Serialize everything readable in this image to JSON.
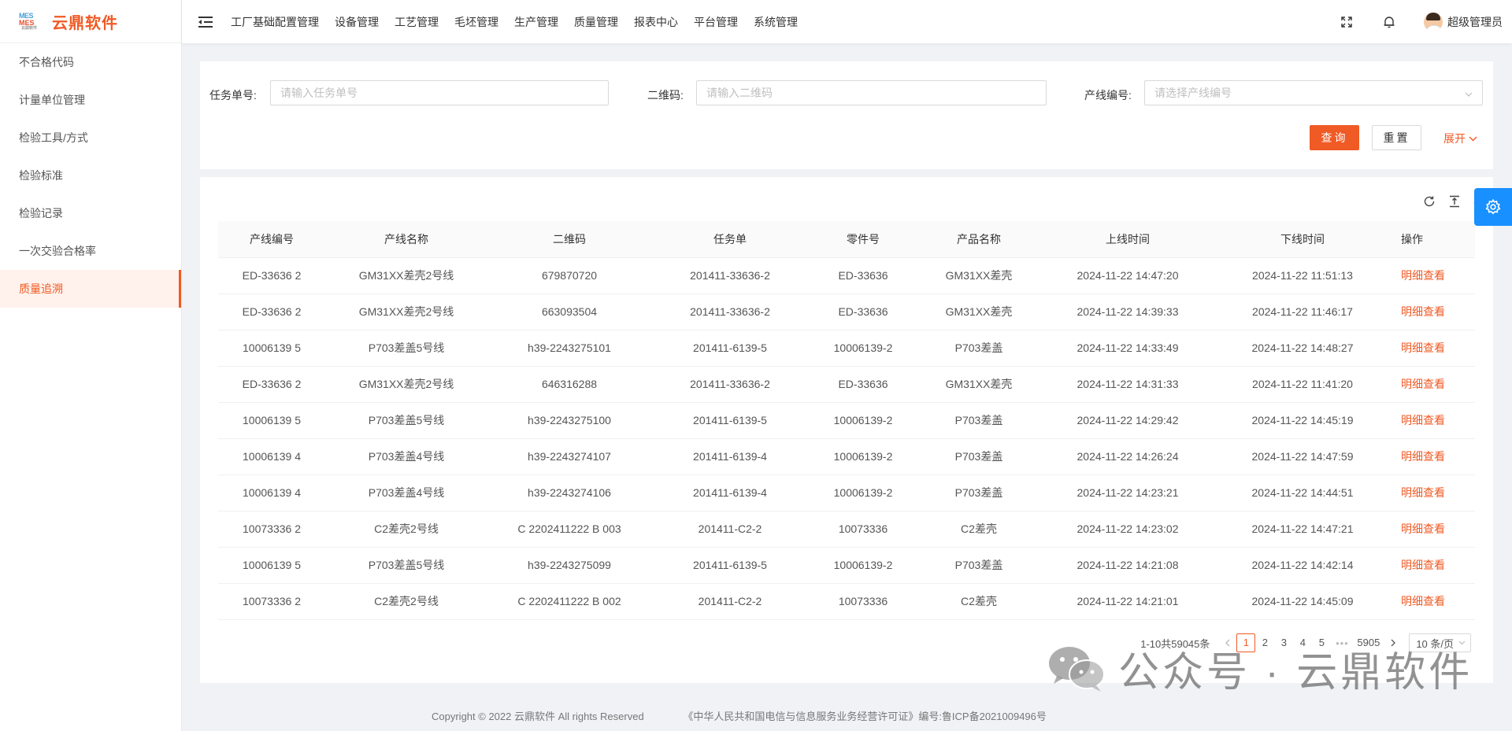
{
  "brand": {
    "logo_line1": "MES",
    "logo_line2": "MES",
    "logo_sub": "云鼎软件",
    "name": "云鼎软件"
  },
  "sidebar": {
    "items": [
      {
        "label": "不合格代码"
      },
      {
        "label": "计量单位管理"
      },
      {
        "label": "检验工具/方式"
      },
      {
        "label": "检验标准"
      },
      {
        "label": "检验记录"
      },
      {
        "label": "一次交验合格率"
      },
      {
        "label": "质量追溯",
        "active": true
      }
    ]
  },
  "header": {
    "nav": [
      "工厂基础配置管理",
      "设备管理",
      "工艺管理",
      "毛坯管理",
      "生产管理",
      "质量管理",
      "报表中心",
      "平台管理",
      "系统管理"
    ],
    "user_name": "超级管理员"
  },
  "search": {
    "task_label": "任务单号:",
    "task_placeholder": "请输入任务单号",
    "qr_label": "二维码:",
    "qr_placeholder": "请输入二维码",
    "line_label": "产线编号:",
    "line_placeholder": "请选择产线编号",
    "query_btn": "查询",
    "reset_btn": "重置",
    "expand": "展开"
  },
  "table": {
    "columns": [
      "产线编号",
      "产线名称",
      "二维码",
      "任务单",
      "零件号",
      "产品名称",
      "上线时间",
      "下线时间",
      "操作"
    ],
    "rows": [
      [
        "ED-33636 2",
        "GM31XX差壳2号线",
        "679870720",
        "201411-33636-2",
        "ED-33636",
        "GM31XX差壳",
        "2024-11-22 14:47:20",
        "2024-11-22 11:51:13",
        "明细查看"
      ],
      [
        "ED-33636 2",
        "GM31XX差壳2号线",
        "663093504",
        "201411-33636-2",
        "ED-33636",
        "GM31XX差壳",
        "2024-11-22 14:39:33",
        "2024-11-22 11:46:17",
        "明细查看"
      ],
      [
        "10006139 5",
        "P703差盖5号线",
        "h39-2243275101",
        "201411-6139-5",
        "10006139-2",
        "P703差盖",
        "2024-11-22 14:33:49",
        "2024-11-22 14:48:27",
        "明细查看"
      ],
      [
        "ED-33636 2",
        "GM31XX差壳2号线",
        "646316288",
        "201411-33636-2",
        "ED-33636",
        "GM31XX差壳",
        "2024-11-22 14:31:33",
        "2024-11-22 11:41:20",
        "明细查看"
      ],
      [
        "10006139 5",
        "P703差盖5号线",
        "h39-2243275100",
        "201411-6139-5",
        "10006139-2",
        "P703差盖",
        "2024-11-22 14:29:42",
        "2024-11-22 14:45:19",
        "明细查看"
      ],
      [
        "10006139 4",
        "P703差盖4号线",
        "h39-2243274107",
        "201411-6139-4",
        "10006139-2",
        "P703差盖",
        "2024-11-22 14:26:24",
        "2024-11-22 14:47:59",
        "明细查看"
      ],
      [
        "10006139 4",
        "P703差盖4号线",
        "h39-2243274106",
        "201411-6139-4",
        "10006139-2",
        "P703差盖",
        "2024-11-22 14:23:21",
        "2024-11-22 14:44:51",
        "明细查看"
      ],
      [
        "10073336 2",
        "C2差壳2号线",
        "C 2202411222 B 003",
        "201411-C2-2",
        "10073336",
        "C2差壳",
        "2024-11-22 14:23:02",
        "2024-11-22 14:47:21",
        "明细查看"
      ],
      [
        "10006139 5",
        "P703差盖5号线",
        "h39-2243275099",
        "201411-6139-5",
        "10006139-2",
        "P703差盖",
        "2024-11-22 14:21:08",
        "2024-11-22 14:42:14",
        "明细查看"
      ],
      [
        "10073336 2",
        "C2差壳2号线",
        "C 2202411222 B 002",
        "201411-C2-2",
        "10073336",
        "C2差壳",
        "2024-11-22 14:21:01",
        "2024-11-22 14:45:09",
        "明细查看"
      ]
    ]
  },
  "pagination": {
    "total_text": "1-10共59045条",
    "pages": [
      "1",
      "2",
      "3",
      "4",
      "5"
    ],
    "current": "1",
    "ellipsis": "•••",
    "last_page": "5905",
    "page_size": "10 条/页"
  },
  "watermark": {
    "text": "公众号 · 云鼎软件"
  },
  "footer": {
    "copyright": "Copyright © 2022 云鼎软件 All rights Reserved",
    "license": "《中华人民共和国电信与信息服务业务经营许可证》编号:鲁ICP备2021009496号"
  },
  "colors": {
    "accent": "#f05a24",
    "side_setting": "#1890ff"
  }
}
